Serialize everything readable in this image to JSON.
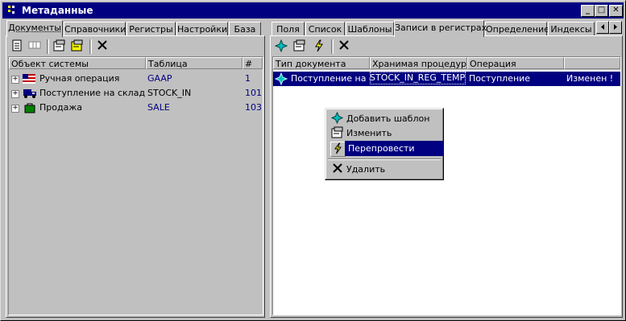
{
  "window": {
    "title": "Метаданные",
    "minimize": "_",
    "maximize": "□",
    "close": "✕"
  },
  "left": {
    "tabs": [
      "Документы",
      "Справочники",
      "Регистры",
      "Настройки",
      "База"
    ],
    "columns": [
      "Объект системы",
      "Таблица",
      "#"
    ],
    "rows": [
      {
        "expander": "+",
        "icon": "flag-icon",
        "name": "Ручная операция",
        "table": "GAAP",
        "num": "1"
      },
      {
        "expander": "+",
        "icon": "truck-icon",
        "name": "Поступление на склад",
        "table": "STOCK_IN",
        "num": "101"
      },
      {
        "expander": "+",
        "icon": "bag-icon",
        "name": "Продажа",
        "table": "SALE",
        "num": "103"
      }
    ]
  },
  "right": {
    "tabs": [
      "Поля",
      "Список",
      "Шаблоны",
      "Записи в регистрах",
      "Определение",
      "Индексы"
    ],
    "columns": [
      "Тип документа",
      "Хранимая процедура",
      "Операция",
      ""
    ],
    "rows": [
      {
        "icon": "star-icon",
        "doc_type": "Поступление на склад",
        "procedure": "STOCK_IN_REG_TEMPLATE",
        "operation": "Поступление",
        "status": "Изменен !"
      }
    ]
  },
  "context_menu": {
    "items": [
      {
        "label": "Добавить шаблон",
        "icon": "star-icon"
      },
      {
        "label": "Изменить",
        "icon": "properties-icon"
      },
      {
        "label": "Перепровести",
        "icon": "lightning-icon"
      },
      {
        "label": "Удалить",
        "icon": "delete-x-icon"
      }
    ]
  },
  "colors": {
    "selection": "#000080",
    "title": "#000080",
    "link": "#000080",
    "muted": "#808080"
  }
}
